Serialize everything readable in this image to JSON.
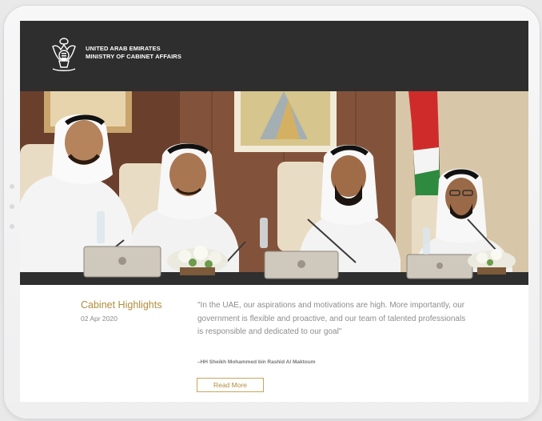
{
  "header": {
    "country": "UNITED ARAB EMIRATES",
    "ministry": "MINISTRY OF CABINET AFFAIRS",
    "emblem_icon": "uae-emblem-icon",
    "background": "#2e2e2e"
  },
  "highlight": {
    "title": "Cabinet Highlights",
    "date": "02 Apr 2020",
    "quote": "\"In the UAE, our aspirations and motivations are high. More importantly, our government is flexible and proactive, and our team of talented professionals is responsible and dedicated to our goal\"",
    "attribution": "–HH Sheikh Mohammed bin Rashid Al Maktoum",
    "read_more_label": "Read More",
    "accent_color": "#b08d3c"
  }
}
